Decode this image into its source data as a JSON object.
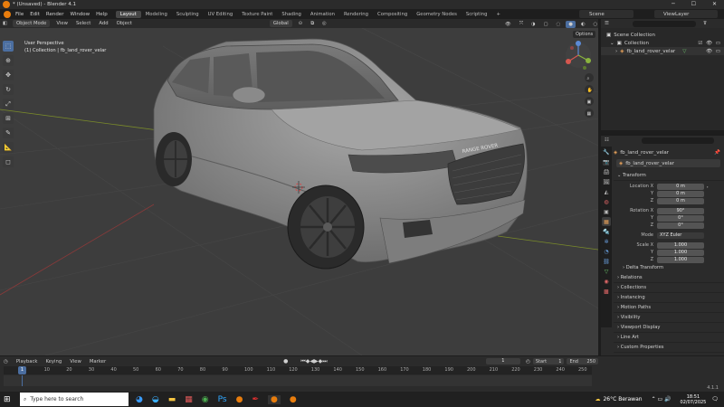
{
  "titlebar": {
    "title": "* (Unsaved) - Blender 4.1"
  },
  "menubar": {
    "menus": [
      "File",
      "Edit",
      "Render",
      "Window",
      "Help"
    ],
    "workspaces": [
      "Layout",
      "Modeling",
      "Sculpting",
      "UV Editing",
      "Texture Paint",
      "Shading",
      "Animation",
      "Rendering",
      "Compositing",
      "Geometry Nodes",
      "Scripting"
    ],
    "active_workspace": "Layout",
    "add_tab": "+",
    "scene": "Scene",
    "view_layer": "ViewLayer"
  },
  "viewport": {
    "mode": "Object Mode",
    "menus": [
      "View",
      "Select",
      "Add",
      "Object"
    ],
    "transform": "Global",
    "overlay_text_1": "User Perspective",
    "overlay_text_2": "(1) Collection | fb_land_rover_velar",
    "options": "Options",
    "grille_text": "RANGE ROVER"
  },
  "outliner": {
    "search_placeholder": "",
    "root": "Scene Collection",
    "collection": "Collection",
    "object": "fb_land_rover_velar"
  },
  "properties": {
    "search_placeholder": "",
    "object_name_top": "fb_land_rover_velar",
    "object_name": "fb_land_rover_velar",
    "transform_header": "Transform",
    "location_label": "Location X",
    "loc": [
      "0 m",
      "0 m",
      "0 m"
    ],
    "rotation_label": "Rotation X",
    "rot": [
      "90°",
      "0°",
      "0°"
    ],
    "mode_label": "Mode",
    "mode_value": "XYZ Euler",
    "scale_label": "Scale X",
    "scale": [
      "1.000",
      "1.000",
      "1.000"
    ],
    "axis_y": "Y",
    "axis_z": "Z",
    "delta": "Delta Transform",
    "sections": [
      "Relations",
      "Collections",
      "Instancing",
      "Motion Paths",
      "Visibility",
      "Viewport Display",
      "Line Art",
      "Custom Properties"
    ]
  },
  "timeline": {
    "menus": [
      "Playback",
      "Keying",
      "View",
      "Marker"
    ],
    "current_frame": "1",
    "start_label": "Start",
    "start": "1",
    "end_label": "End",
    "end": "250",
    "ticks": [
      "1",
      "10",
      "20",
      "30",
      "40",
      "50",
      "60",
      "70",
      "80",
      "90",
      "100",
      "110",
      "120",
      "130",
      "140",
      "150",
      "160",
      "170",
      "180",
      "190",
      "200",
      "210",
      "220",
      "230",
      "240",
      "250"
    ]
  },
  "status": {
    "version": "4.1.1"
  },
  "taskbar": {
    "search_placeholder": "Type here to search",
    "weather": "26°C Berawan",
    "time": "18:51",
    "date": "02/07/2025"
  },
  "colors": {
    "accent": "#4b6ea0",
    "blender_orange": "#e87d0d"
  }
}
